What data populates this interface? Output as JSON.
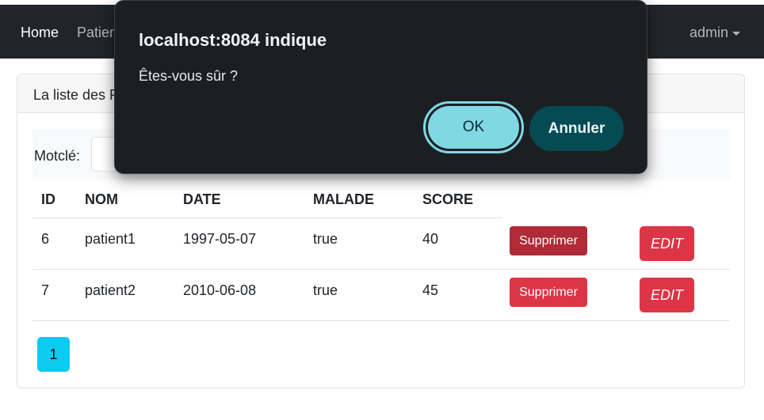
{
  "navbar": {
    "home": "Home",
    "patients": "Patients",
    "user": "admin"
  },
  "card": {
    "title": "La liste des Patients"
  },
  "search": {
    "label": "Motclé:",
    "value": ""
  },
  "table": {
    "headers": [
      "ID",
      "NOM",
      "DATE",
      "MALADE",
      "SCORE"
    ],
    "rows": [
      {
        "id": "6",
        "nom": "patient1",
        "date": "1997-05-07",
        "malade": "true",
        "score": "40",
        "delete": "Supprimer",
        "edit": "EDIT"
      },
      {
        "id": "7",
        "nom": "patient2",
        "date": "2010-06-08",
        "malade": "true",
        "score": "45",
        "delete": "Supprimer",
        "edit": "EDIT"
      }
    ]
  },
  "pagination": {
    "pages": [
      "1"
    ]
  },
  "dialog": {
    "title": "localhost:8084 indique",
    "message": "Êtes-vous sûr ?",
    "ok": "OK",
    "cancel": "Annuler"
  }
}
